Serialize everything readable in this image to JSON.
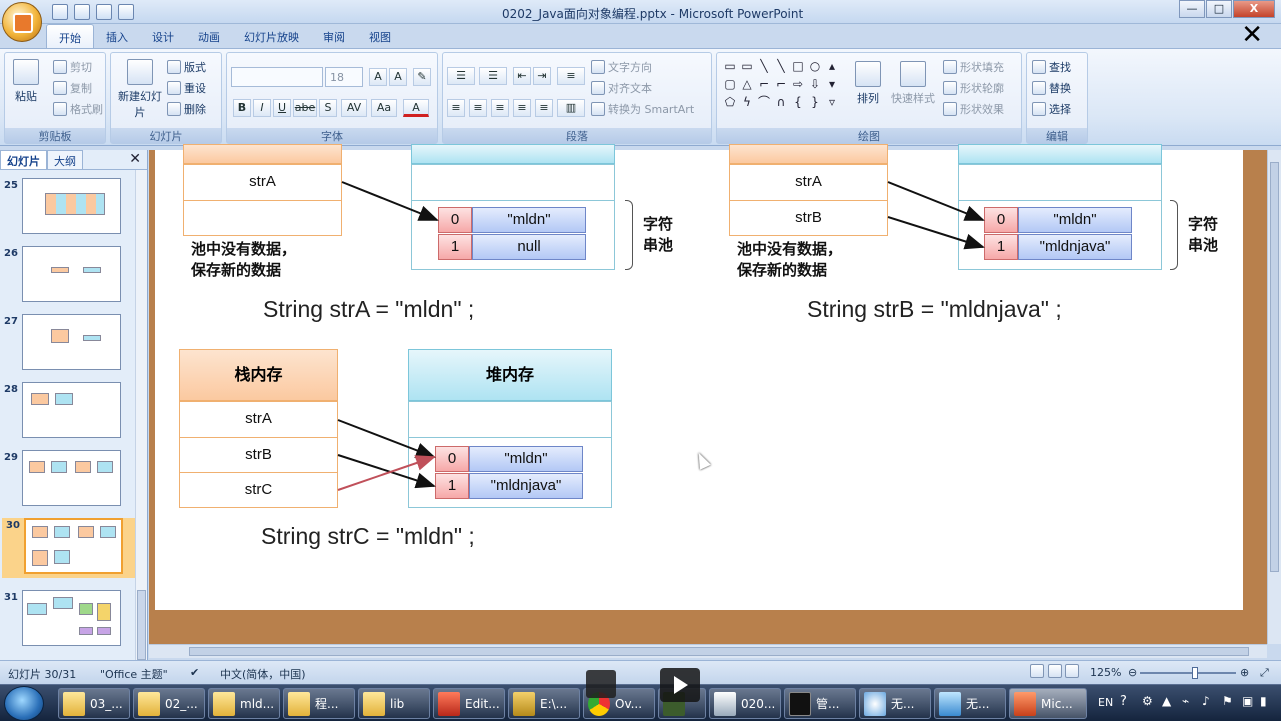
{
  "window": {
    "title": "0202_Java面向对象编程.pptx - Microsoft PowerPoint",
    "controls": [
      "—",
      "□",
      "X"
    ]
  },
  "ribbon_tabs": [
    "开始",
    "插入",
    "设计",
    "动画",
    "幻灯片放映",
    "审阅",
    "视图"
  ],
  "ribbon": {
    "clipboard": {
      "paste": "粘贴",
      "cut": "剪切",
      "copy": "复制",
      "format_painter": "格式刷",
      "label": "剪贴板"
    },
    "slides": {
      "new_slide": "新建幻灯片",
      "layout": "版式",
      "reset": "重设",
      "delete": "删除",
      "label": "幻灯片"
    },
    "font": {
      "font_size": "18",
      "label": "字体",
      "bold": "B",
      "italic": "I",
      "underline": "U",
      "strike": "abe",
      "shadow": "S",
      "spacing": "AV",
      "case": "Aa",
      "color": "A"
    },
    "paragraph": {
      "text_direction": "文字方向",
      "align_text": "对齐文本",
      "smartart": "转换为 SmartArt",
      "label": "段落"
    },
    "drawing": {
      "arrange": "排列",
      "quick_styles": "快速样式",
      "shape_fill": "形状填充",
      "shape_outline": "形状轮廓",
      "shape_effects": "形状效果",
      "label": "绘图"
    },
    "editing": {
      "find": "查找",
      "replace": "替换",
      "select": "选择",
      "label": "编辑"
    }
  },
  "left_panel": {
    "tabs": [
      "幻灯片",
      "大纲"
    ],
    "close": "✕",
    "slides": [
      {
        "num": "25"
      },
      {
        "num": "26"
      },
      {
        "num": "27"
      },
      {
        "num": "28"
      },
      {
        "num": "29"
      },
      {
        "num": "30",
        "selected": true
      },
      {
        "num": "31"
      }
    ]
  },
  "slide": {
    "panels": [
      {
        "stack_vars": [
          "strA",
          ""
        ],
        "heap": [
          {
            "idx": "0",
            "val": "\"mldn\""
          },
          {
            "idx": "1",
            "val": "null"
          }
        ],
        "note_line1": "池中没有数据，",
        "note_line2": "保存新的数据",
        "brace_label_1": "字符",
        "brace_label_2": "串池",
        "code": "String strA = \"mldn\" ;"
      },
      {
        "stack_vars": [
          "strA",
          "strB"
        ],
        "heap": [
          {
            "idx": "0",
            "val": "\"mldn\""
          },
          {
            "idx": "1",
            "val": "\"mldnjava\""
          }
        ],
        "note_line1": "池中没有数据，",
        "note_line2": "保存新的数据",
        "brace_label_1": "字符",
        "brace_label_2": "串池",
        "code": "String strB = \"mldnjava\" ;"
      },
      {
        "stack_title": "栈内存",
        "heap_title": "堆内存",
        "stack_vars": [
          "strA",
          "strB",
          "strC"
        ],
        "heap": [
          {
            "idx": "0",
            "val": "\"mldn\""
          },
          {
            "idx": "1",
            "val": "\"mldnjava\""
          }
        ],
        "code": "String strC = \"mldn\" ;"
      }
    ]
  },
  "status": {
    "slide_info": "幻灯片 30/31",
    "theme": "\"Office 主题\"",
    "language": "中文(简体，中国)",
    "zoom": "125%"
  },
  "taskbar": {
    "items": [
      {
        "label": "03_..."
      },
      {
        "label": "02_..."
      },
      {
        "label": "mld..."
      },
      {
        "label": "程..."
      },
      {
        "label": "lib"
      },
      {
        "label": "Edit..."
      },
      {
        "label": "E:\\..."
      },
      {
        "label": "Ov..."
      },
      {
        "label": "020..."
      },
      {
        "label": "管..."
      },
      {
        "label": "无..."
      },
      {
        "label": "无..."
      },
      {
        "label": "Mic..."
      }
    ],
    "tray_lang": "EN"
  },
  "colors": {
    "stack_header": "#fbc9a0",
    "heap_header": "#aee3f2",
    "index_cell": "#f6a8a8",
    "value_cell": "#b3c8f5",
    "slide_frame": "#b8804c"
  }
}
